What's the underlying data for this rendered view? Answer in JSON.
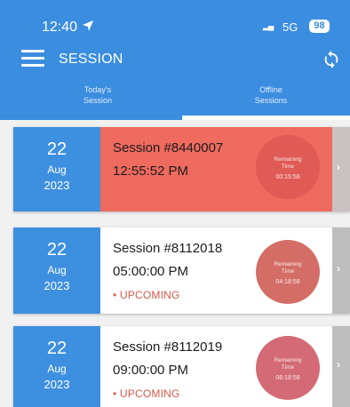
{
  "status_bar": {
    "time": "12:40",
    "location_icon": "location-arrow-icon",
    "signal": "▂▄",
    "network": "5G",
    "battery": "98"
  },
  "appbar": {
    "menu_icon": "hamburger-menu-icon",
    "title": "SESSION",
    "sync_icon": "sync-icon"
  },
  "tabs": [
    {
      "label_line1": "Today's",
      "label_line2": "Session",
      "active": true
    },
    {
      "label_line1": "Offline",
      "label_line2": "Sessions",
      "active": false
    }
  ],
  "colors": {
    "header_bg": "#3b8de0",
    "date_block_bg": "#3d8fe0",
    "active_card_bg": "#ef6a5f",
    "upcoming_status": "#d65a4a",
    "chevron_bar": "#bdbdbd"
  },
  "sessions": [
    {
      "day": "22",
      "month": "Aug",
      "year": "2023",
      "title": "Session #8440007",
      "time": "12:55:52 PM",
      "status": "",
      "timer_line1": "Remaining",
      "timer_line2": "Time",
      "timer_value": "00:15:58"
    },
    {
      "day": "22",
      "month": "Aug",
      "year": "2023",
      "title": "Session #8112018",
      "time": "05:00:00 PM",
      "status": "• UPCOMING",
      "timer_line1": "Remaining",
      "timer_line2": "Time",
      "timer_value": "04:18:58"
    },
    {
      "day": "22",
      "month": "Aug",
      "year": "2023",
      "title": "Session #8112019",
      "time": "09:00:00 PM",
      "status": "• UPCOMING",
      "timer_line1": "Remaining",
      "timer_line2": "Time",
      "timer_value": "08:18:58"
    }
  ],
  "chevron_label": "›"
}
